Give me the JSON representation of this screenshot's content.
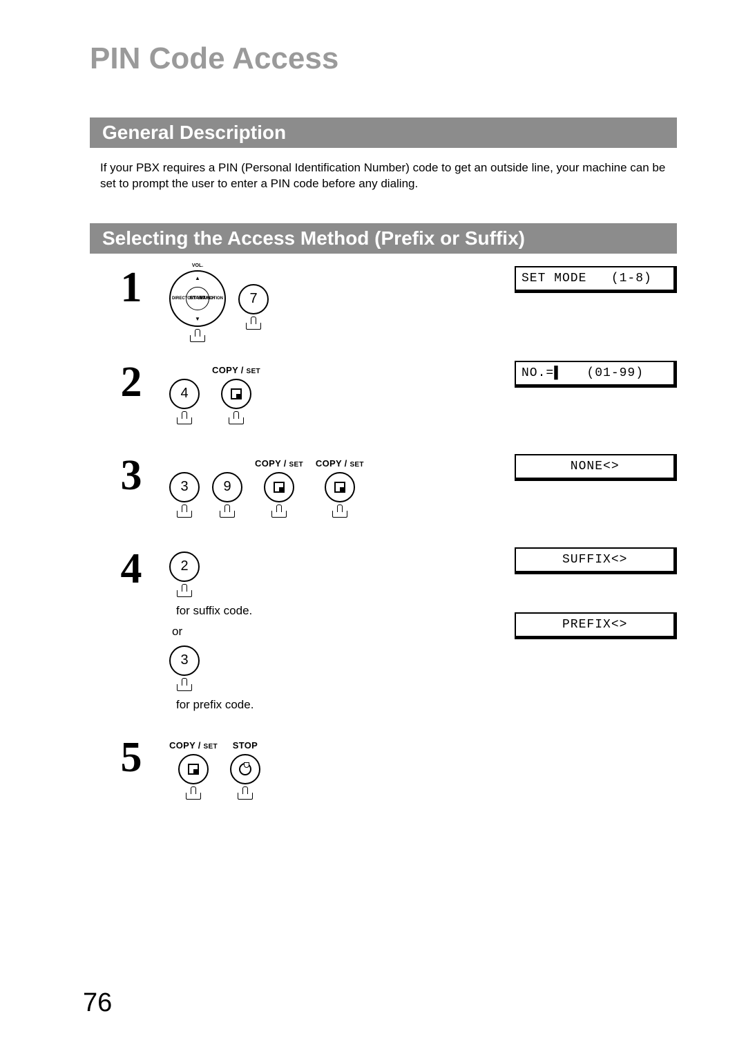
{
  "title": "PIN Code Access",
  "section1": "General Description",
  "desc": "If your PBX requires a PIN (Personal Identification Number) code to get an outside line, your machine can be set to prompt the user to enter a PIN code before any dialing.",
  "section2": "Selecting the Access Method (Prefix or Suffix)",
  "btn": {
    "copy": "COPY / ",
    "set": "SET",
    "stop": "STOP",
    "nav_start": "START",
    "nav_vol": "VOL.",
    "nav_dir": "DIRECTORY SEARCH",
    "nav_func": "FUNCTION"
  },
  "nums": {
    "n2": "2",
    "n3": "3",
    "n4": "4",
    "n7": "7",
    "n9": "9"
  },
  "stepnums": {
    "s1": "1",
    "s2": "2",
    "s3": "3",
    "s4": "4",
    "s5": "5"
  },
  "captions": {
    "suffix": "for suffix code.",
    "or": "or",
    "prefix": "for prefix code."
  },
  "lcd": {
    "l1": "SET MODE   (1-8)",
    "l2": "NO.=▌   (01-99)",
    "l3": "      NONE<>",
    "l4a": "     SUFFIX<>",
    "l4b": "     PREFIX<>"
  },
  "pagenum": "76"
}
